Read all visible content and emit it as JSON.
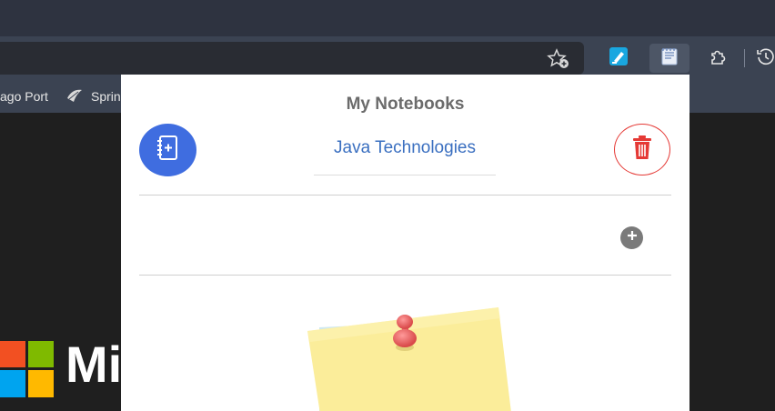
{
  "browser": {
    "bookmarks": [
      {
        "label": "ago Port"
      },
      {
        "label": "Sprin"
      }
    ]
  },
  "background_page": {
    "brand_text": "Mic"
  },
  "popup": {
    "title": "My Notebooks",
    "notebook_name": "Java Technologies"
  },
  "icons": {
    "favorite": "star-add-icon",
    "extension_highlighter": "highlighter-icon",
    "extension_notebook": "notebook-icon",
    "extensions": "puzzle-icon",
    "history": "history-icon",
    "new_notebook": "notebook-add-icon",
    "delete": "trash-icon",
    "add_note": "plus-circle-icon"
  },
  "colors": {
    "accent_blue": "#3f6de0",
    "delete_red": "#e53935",
    "notebook_name": "#3a6fc0"
  }
}
